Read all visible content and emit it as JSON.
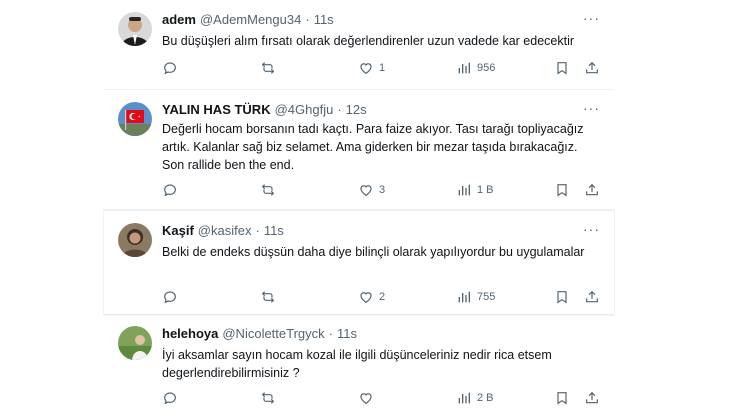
{
  "tweets": [
    {
      "name": "adem",
      "handle": "@AdemMengu34",
      "dot": "·",
      "time": "11s",
      "text": "Bu düşüşleri alım fırsatı olarak değerlendirenler uzun vadede kar edecektir",
      "replies": "",
      "retweets": "",
      "likes": "1",
      "views": "956",
      "more": "···"
    },
    {
      "name": "YALIN HAS TÜRK",
      "handle": "@4Ghgfju",
      "dot": "·",
      "time": "12s",
      "text": "Değerli hocam borsanın tadı kaçtı. Para faize akıyor. Tası tarağı topliyacağız artık. Kalanlar sağ biz selamet. Ama giderken bir mezar taşıda bırakacağız. Son rallide ben the end.",
      "replies": "",
      "retweets": "",
      "likes": "3",
      "views": "1 B",
      "more": "···"
    },
    {
      "name": "Kaşif",
      "handle": "@kasifex",
      "dot": "·",
      "time": "11s",
      "text": "Belki de endeks düşsün daha diye bilinçli olarak yapılıyordur bu uygulamalar",
      "replies": "",
      "retweets": "",
      "likes": "2",
      "views": "755",
      "more": "···"
    },
    {
      "name": "helehoya",
      "handle": "@NicoletteTrgyck",
      "dot": "·",
      "time": "11s",
      "text": "İyi aksamlar sayın hocam kozal ile ilgili düşünceleriniz nedir rica etsem degerlendirebilirmisiniz ?",
      "replies": "",
      "retweets": "",
      "likes": "",
      "views": "2 B",
      "more": ""
    }
  ],
  "icons": {
    "reply": "reply-icon",
    "retweet": "retweet-icon",
    "like": "heart-icon",
    "views": "views-icon",
    "bookmark": "bookmark-icon",
    "share": "share-icon"
  },
  "colors": {
    "text": "#0f1419",
    "secondary": "#536471",
    "divider": "#eff3f4"
  }
}
